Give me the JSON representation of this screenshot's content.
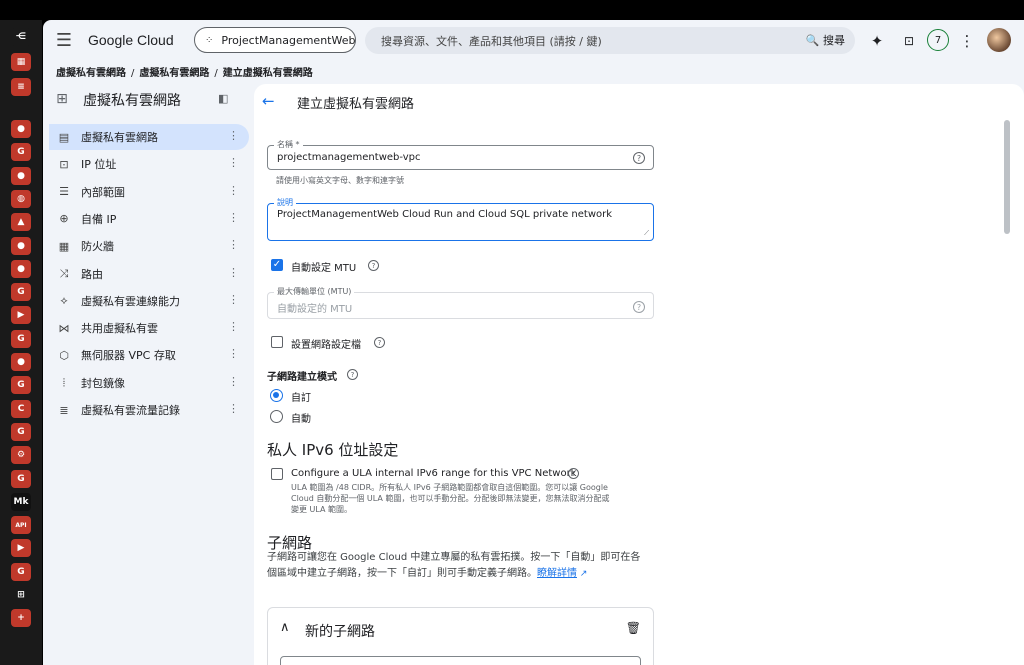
{
  "dock": {
    "items": [
      {
        "icon": "sidebar-toggle-icon",
        "glyph": "⋲",
        "color": "#1a1a1a"
      },
      {
        "icon": "apps-grid-icon",
        "glyph": "▦",
        "color": "#c0392b"
      },
      {
        "icon": "search-list-icon",
        "glyph": "≡",
        "color": "#c0392b"
      },
      {
        "icon": "github-icon",
        "glyph": "●",
        "color": "#c0392b"
      },
      {
        "icon": "google-icon",
        "glyph": "G",
        "color": "#c0392b"
      },
      {
        "icon": "github-icon",
        "glyph": "●",
        "color": "#c0392b"
      },
      {
        "icon": "globe-icon",
        "glyph": "◍",
        "color": "#c0392b"
      },
      {
        "icon": "drive-icon",
        "glyph": "▲",
        "color": "#c0392b"
      },
      {
        "icon": "github-icon",
        "glyph": "●",
        "color": "#c0392b"
      },
      {
        "icon": "github-icon",
        "glyph": "●",
        "color": "#c0392b"
      },
      {
        "icon": "google-icon",
        "glyph": "G",
        "color": "#c0392b"
      },
      {
        "icon": "youtube-icon",
        "glyph": "▶",
        "color": "#c0392b"
      },
      {
        "icon": "google-icon",
        "glyph": "G",
        "color": "#c0392b"
      },
      {
        "icon": "github-icon",
        "glyph": "●",
        "color": "#c0392b"
      },
      {
        "icon": "g-app-icon",
        "glyph": "G",
        "color": "#c0392b"
      },
      {
        "icon": "c-app-icon",
        "glyph": "C",
        "color": "#c0392b"
      },
      {
        "icon": "g-app-icon",
        "glyph": "G",
        "color": "#c0392b"
      },
      {
        "icon": "settings-icon",
        "glyph": "⚙",
        "color": "#c0392b"
      },
      {
        "icon": "google-icon",
        "glyph": "G",
        "color": "#c0392b"
      },
      {
        "icon": "mk-app-icon",
        "glyph": "Mk",
        "color": "#111111"
      },
      {
        "icon": "api-app-icon",
        "glyph": "API",
        "color": "#c0392b"
      },
      {
        "icon": "youtube-icon",
        "glyph": "▶",
        "color": "#c0392b"
      },
      {
        "icon": "google-icon",
        "glyph": "G",
        "color": "#c0392b"
      },
      {
        "icon": "network-app-icon",
        "glyph": "⊞",
        "color": "#1a1a1a"
      },
      {
        "icon": "add-icon",
        "glyph": "+",
        "color": "#c0392b"
      }
    ]
  },
  "header": {
    "menu_icon": "☰",
    "brand": "Google Cloud",
    "project": "ProjectManagementWeb",
    "search_placeholder": "搜尋資源、文件、產品和其他項目 (請按 / 鍵)",
    "search_button": "🔍 搜尋",
    "notifications": "7"
  },
  "breadcrumb": [
    "虛擬私有雲網路",
    "虛擬私有雲網路",
    "建立虛擬私有雲網路"
  ],
  "sidebar": {
    "title": "虛擬私有雲網路",
    "items": [
      {
        "label": "虛擬私有雲網路",
        "icon": "vpc-network-icon",
        "glyph": "▤",
        "active": true
      },
      {
        "label": "IP 位址",
        "icon": "ip-address-icon",
        "glyph": "⊡",
        "active": false
      },
      {
        "label": "內部範圍",
        "icon": "internal-ranges-icon",
        "glyph": "☰",
        "active": false
      },
      {
        "label": "自備 IP",
        "icon": "byoip-icon",
        "glyph": "⊕",
        "active": false
      },
      {
        "label": "防火牆",
        "icon": "firewall-icon",
        "glyph": "▦",
        "active": false
      },
      {
        "label": "路由",
        "icon": "routes-icon",
        "glyph": "⤨",
        "active": false
      },
      {
        "label": "虛擬私有雲連線能力",
        "icon": "connectivity-icon",
        "glyph": "⟡",
        "active": false
      },
      {
        "label": "共用虛擬私有雲",
        "icon": "shared-vpc-icon",
        "glyph": "⋈",
        "active": false
      },
      {
        "label": "無伺服器 VPC 存取",
        "icon": "serverless-icon",
        "glyph": "⬡",
        "active": false
      },
      {
        "label": "封包鏡像",
        "icon": "packet-mirroring-icon",
        "glyph": "⦙",
        "active": false
      },
      {
        "label": "虛擬私有雲流量記錄",
        "icon": "flow-logs-icon",
        "glyph": "≣",
        "active": false
      }
    ]
  },
  "form": {
    "page_title": "建立虛擬私有雲網路",
    "name_label": "名稱 *",
    "name_value": "projectmanagementweb-vpc",
    "name_hint": "請使用小寫英文字母、數字和連字號",
    "desc_label": "說明",
    "desc_value": "ProjectManagementWeb Cloud Run and Cloud SQL private network",
    "auto_mtu_label": "自動設定 MTU",
    "auto_mtu_checked": true,
    "mtu_label": "最大傳輸單位 (MTU)",
    "mtu_placeholder": "自動設定的 MTU",
    "profile_label": "設置網路設定檔",
    "subnet_mode_label": "子網路建立模式",
    "mode_custom": "自訂",
    "mode_auto": "自動",
    "ipv6_heading": "私人 IPv6 位址設定",
    "ula_label": "Configure a ULA internal IPv6 range for this VPC Network",
    "ula_desc_1": "ULA 範圍為 /48 CIDR。所有私人 IPv6 子網路範圍都會取自這個範圍。您可以讓 Google",
    "ula_desc_2": "Cloud 自動分配一個 ULA 範圍，也可以手動分配。分配後即無法變更，您無法取消分配或",
    "ula_desc_3": "變更 ULA 範圍。",
    "subnets_heading": "子網路",
    "subnets_desc_1": "子網路可讓您在 Google Cloud 中建立專屬的私有雲拓撲。按一下「自動」即可在各",
    "subnets_desc_2": "個區域中建立子網路，按一下「自訂」則可手動定義子網路。",
    "learn_more": "瞭解詳情",
    "new_subnet": "新的子網路"
  }
}
